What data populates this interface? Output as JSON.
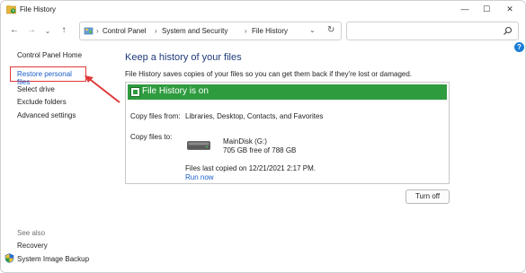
{
  "window": {
    "title": "File History",
    "minimize_glyph": "—",
    "maximize_glyph": "☐",
    "close_glyph": "✕"
  },
  "nav": {
    "back_glyph": "←",
    "forward_glyph": "→",
    "recent_glyph": "⌄",
    "up_glyph": "↑"
  },
  "address": {
    "breadcrumb": [
      "Control Panel",
      "System and Security",
      "File History"
    ],
    "separator": "›",
    "dropdown_glyph": "⌄",
    "refresh_glyph": "↻"
  },
  "search": {
    "placeholder": ""
  },
  "help": {
    "glyph": "?"
  },
  "sidebar": {
    "home": "Control Panel Home",
    "items": [
      "Restore personal files",
      "Select drive",
      "Exclude folders",
      "Advanced settings"
    ],
    "see_also_label": "See also",
    "see_also_items": [
      "Recovery",
      "System Image Backup"
    ]
  },
  "main": {
    "heading": "Keep a history of your files",
    "description": "File History saves copies of your files so you can get them back if they're lost or damaged.",
    "status_title": "File History is on",
    "copy_from_label": "Copy files from:",
    "copy_from_value": "Libraries, Desktop, Contacts, and Favorites",
    "copy_to_label": "Copy files to:",
    "drive_name": "MainDisk (G:)",
    "drive_space": "705 GB free of 788 GB",
    "last_copied": "Files last copied on 12/21/2021 2:17 PM.",
    "run_now": "Run now",
    "turn_off": "Turn off"
  },
  "colors": {
    "accent_link": "#1a5ec7",
    "status_green": "#2f9b3f",
    "highlight_red": "#e03a3a",
    "heading_blue": "#1e3a7a"
  },
  "icons": {
    "title": "file-history-icon",
    "address": "control-panel-icon",
    "search": "search-icon",
    "drive": "hard-drive-icon",
    "backup": "shield-icon"
  }
}
